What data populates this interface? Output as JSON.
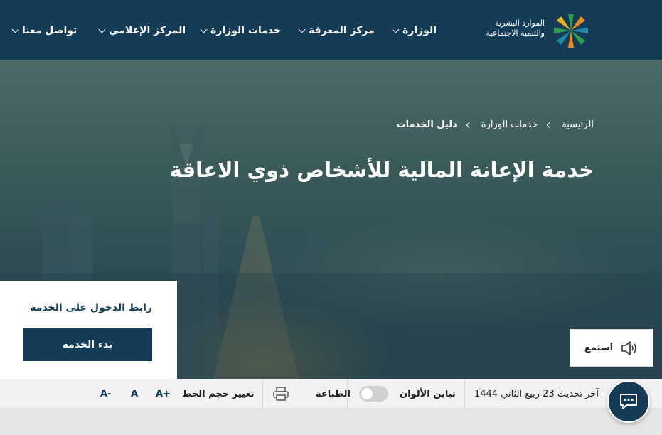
{
  "navbar": {
    "logo": {
      "line1": "الموارد البشرية",
      "line2": "والتنمية الاجتماعية",
      "icon": "ministry-logo-icon"
    },
    "items": [
      {
        "label": "الوزارة"
      },
      {
        "label": "مركز المعرفة"
      },
      {
        "label": "خدمات الوزارة"
      },
      {
        "label": "المركز الإعلامي"
      },
      {
        "label": "تواصل معنا"
      }
    ]
  },
  "breadcrumb": {
    "items": [
      {
        "label": "الرئيسية"
      },
      {
        "label": "خدمات الوزارة"
      },
      {
        "label": "دليل الخدمات"
      }
    ]
  },
  "hero": {
    "title": "خدمة الإعانة المالية للأشخاص ذوي الاعاقة"
  },
  "service_card": {
    "title": "رابط الدخول على الخدمة",
    "button_label": "بدء الخدمة"
  },
  "listen": {
    "label": "استمع",
    "icon": "speaker-icon"
  },
  "toolbar": {
    "last_update": "آخر تحديث 23 ربيع الثاني 1444",
    "contrast_label": "تباين الألوان",
    "contrast_enabled": false,
    "print_label": "الطباعة",
    "print_icon": "printer-icon",
    "font_size_label": "تغيير حجم الخط",
    "font_increase": "A+",
    "font_default": "A",
    "font_decrease": "A-"
  },
  "chat": {
    "icon": "chat-icon"
  },
  "colors": {
    "primary": "#143c57",
    "accent_green": "#2e9e4f",
    "accent_orange": "#f08c1e",
    "accent_teal": "#1f8aa6"
  }
}
